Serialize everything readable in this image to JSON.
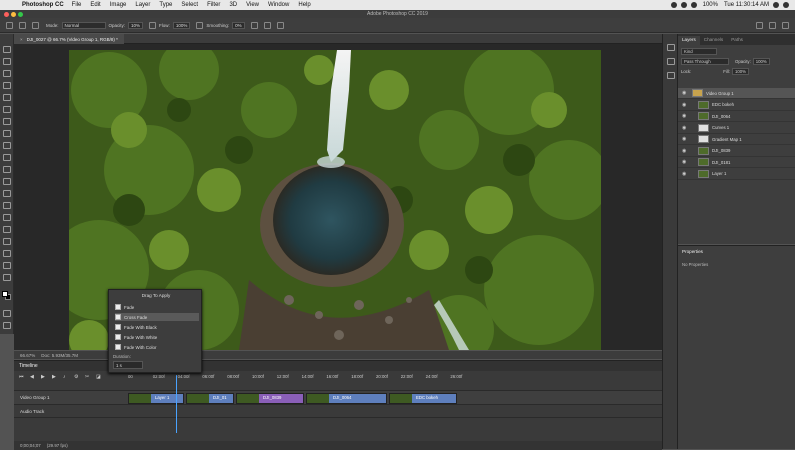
{
  "menubar": {
    "app_name": "Photoshop CC",
    "items": [
      "File",
      "Edit",
      "Image",
      "Layer",
      "Type",
      "Select",
      "Filter",
      "3D",
      "View",
      "Window",
      "Help"
    ],
    "battery": "100%",
    "clock": "Tue 11:30:14 AM"
  },
  "window": {
    "title": "Adobe Photoshop CC 2019"
  },
  "options": {
    "mode_label": "Mode:",
    "mode_value": "Normal",
    "opacity_label": "Opacity:",
    "opacity_value": "10%",
    "flow_label": "Flow:",
    "flow_value": "100%",
    "smoothing_label": "Smoothing:",
    "smoothing_value": "0%"
  },
  "document": {
    "tab_label": "DJI_0027 @ 66.7% (Video Group 1, RGB/8) *"
  },
  "status": {
    "zoom": "66.67%",
    "doc_size": "Doc: 5.93M/35.7M"
  },
  "transition_menu": {
    "title": "Drag To Apply",
    "items": [
      "Fade",
      "Cross Fade",
      "Fade With Black",
      "Fade With White",
      "Fade With Color"
    ],
    "selected_index": 1,
    "duration_label": "Duration:",
    "duration_value": "1 s"
  },
  "timeline": {
    "title": "Timeline",
    "ticks": [
      "00",
      "02:00f",
      "04:00f",
      "06:00f",
      "08:00f",
      "10:00f",
      "12:00f",
      "14:00f",
      "16:00f",
      "18:00f",
      "20:00f",
      "22:00f",
      "24:00f",
      "26:00f"
    ],
    "video_track": "Video Group 1",
    "audio_track": "Audio Track",
    "clips": [
      {
        "label": "Layer 1",
        "color": "#5e7fbd"
      },
      {
        "label": "DJI_01",
        "color": "#5e7fbd"
      },
      {
        "label": "DJI_0839",
        "color": "#8a5fb8"
      },
      {
        "label": "DJI_0064",
        "color": "#5e7fbd"
      },
      {
        "label": "EDC bokeh",
        "color": "#5e7fbd"
      }
    ],
    "timecode": "0;00;04;07",
    "fps": "(29.97 fps)"
  },
  "layers_panel": {
    "tabs": [
      "Layers",
      "Channels",
      "Paths"
    ],
    "kind_label": "Kind",
    "blend_mode": "Pass Through",
    "opacity_label": "Opacity:",
    "opacity_value": "100%",
    "lock_label": "Lock:",
    "fill_label": "Fill:",
    "fill_value": "100%",
    "layers": [
      {
        "name": "Video Group 1",
        "type": "group"
      },
      {
        "name": "EDC bokeh",
        "type": "video"
      },
      {
        "name": "DJI_0064",
        "type": "video"
      },
      {
        "name": "Curves 1",
        "type": "adjustment"
      },
      {
        "name": "Gradient Map 1",
        "type": "adjustment"
      },
      {
        "name": "DJI_0839",
        "type": "video"
      },
      {
        "name": "DJI_0181",
        "type": "video"
      },
      {
        "name": "Layer 1",
        "type": "video"
      }
    ]
  },
  "properties_panel": {
    "title": "Properties",
    "empty_text": "No Properties"
  }
}
